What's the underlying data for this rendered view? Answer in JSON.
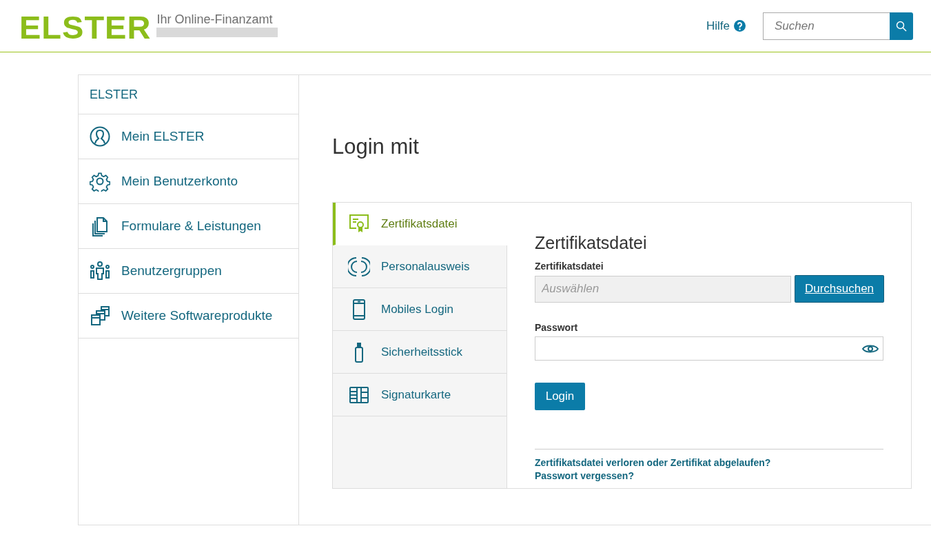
{
  "header": {
    "logo": "ELSTER",
    "tagline": "Ihr Online-Finanzamt",
    "help_link": "Hilfe",
    "search": {
      "placeholder": "Suchen"
    }
  },
  "sidebar": {
    "heading": "ELSTER",
    "items": [
      {
        "label": "Mein ELSTER"
      },
      {
        "label": "Mein Benutzerkonto"
      },
      {
        "label": "Formulare & Leistungen"
      },
      {
        "label": "Benutzergruppen"
      },
      {
        "label": "Weitere Softwareprodukte"
      }
    ]
  },
  "main": {
    "title": "Login mit",
    "tabs": [
      {
        "label": "Zertifikatsdatei",
        "selected": true
      },
      {
        "label": "Personalausweis",
        "selected": false
      },
      {
        "label": "Mobiles Login",
        "selected": false
      },
      {
        "label": "Sicherheitsstick",
        "selected": false
      },
      {
        "label": "Signaturkarte",
        "selected": false
      }
    ],
    "form": {
      "title": "Zertifikatsdatei",
      "file_label": "Zertifikatsdatei",
      "file_placeholder": "Auswählen",
      "browse_button": "Durchsuchen",
      "password_label": "Passwort",
      "login_button": "Login",
      "links": [
        "Zertifikatsdatei verloren oder Zertifikat abgelaufen?",
        "Passwort vergessen?"
      ]
    }
  }
}
